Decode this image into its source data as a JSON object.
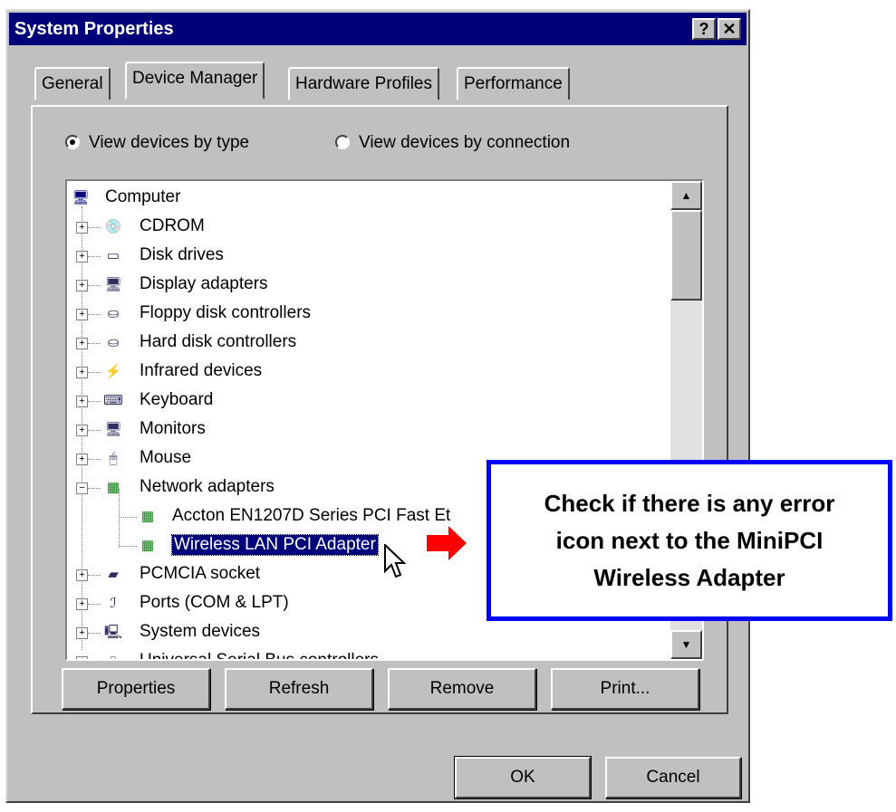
{
  "window": {
    "title": "System Properties",
    "help_button": "?",
    "close_button": "✕"
  },
  "tabs": [
    {
      "label": "General"
    },
    {
      "label": "Device Manager"
    },
    {
      "label": "Hardware Profiles"
    },
    {
      "label": "Performance"
    }
  ],
  "view_options": {
    "by_type": "View devices by type",
    "by_connection": "View devices by connection",
    "selected": "by_type"
  },
  "tree": {
    "root": "Computer",
    "items": [
      {
        "label": "CDROM",
        "icon": "cdrom-icon",
        "expander": "+"
      },
      {
        "label": "Disk drives",
        "icon": "disk-drive-icon",
        "expander": "+"
      },
      {
        "label": "Display adapters",
        "icon": "display-icon",
        "expander": "+"
      },
      {
        "label": "Floppy disk controllers",
        "icon": "controller-icon",
        "expander": "+"
      },
      {
        "label": "Hard disk controllers",
        "icon": "controller-icon",
        "expander": "+"
      },
      {
        "label": "Infrared devices",
        "icon": "infrared-icon",
        "expander": "+"
      },
      {
        "label": "Keyboard",
        "icon": "keyboard-icon",
        "expander": "+"
      },
      {
        "label": "Monitors",
        "icon": "monitor-icon",
        "expander": "+"
      },
      {
        "label": "Mouse",
        "icon": "mouse-icon",
        "expander": "+"
      },
      {
        "label": "Network adapters",
        "icon": "network-icon",
        "expander": "-"
      },
      {
        "label": "Accton EN1207D Series PCI Fast Et",
        "icon": "network-icon",
        "child": true
      },
      {
        "label": "Wireless LAN PCI Adapter",
        "icon": "network-icon",
        "child": true,
        "selected": true
      },
      {
        "label": "PCMCIA socket",
        "icon": "pcmcia-icon",
        "expander": "+"
      },
      {
        "label": "Ports (COM & LPT)",
        "icon": "port-icon",
        "expander": "+"
      },
      {
        "label": "System devices",
        "icon": "system-icon",
        "expander": "+"
      },
      {
        "label": "Universal Serial Bus controllers",
        "icon": "usb-icon",
        "expander": "+"
      }
    ]
  },
  "buttons": {
    "properties": "Properties",
    "refresh": "Refresh",
    "remove": "Remove",
    "print": "Print...",
    "ok": "OK",
    "cancel": "Cancel"
  },
  "callout": {
    "text": "Check if there is any error\nicon next to the MiniPCI\nWireless Adapter"
  },
  "colors": {
    "titlebar": "#00007b",
    "callout_border": "#0000ff",
    "arrow": "#ff0000",
    "window_face": "#c0c0c0"
  }
}
